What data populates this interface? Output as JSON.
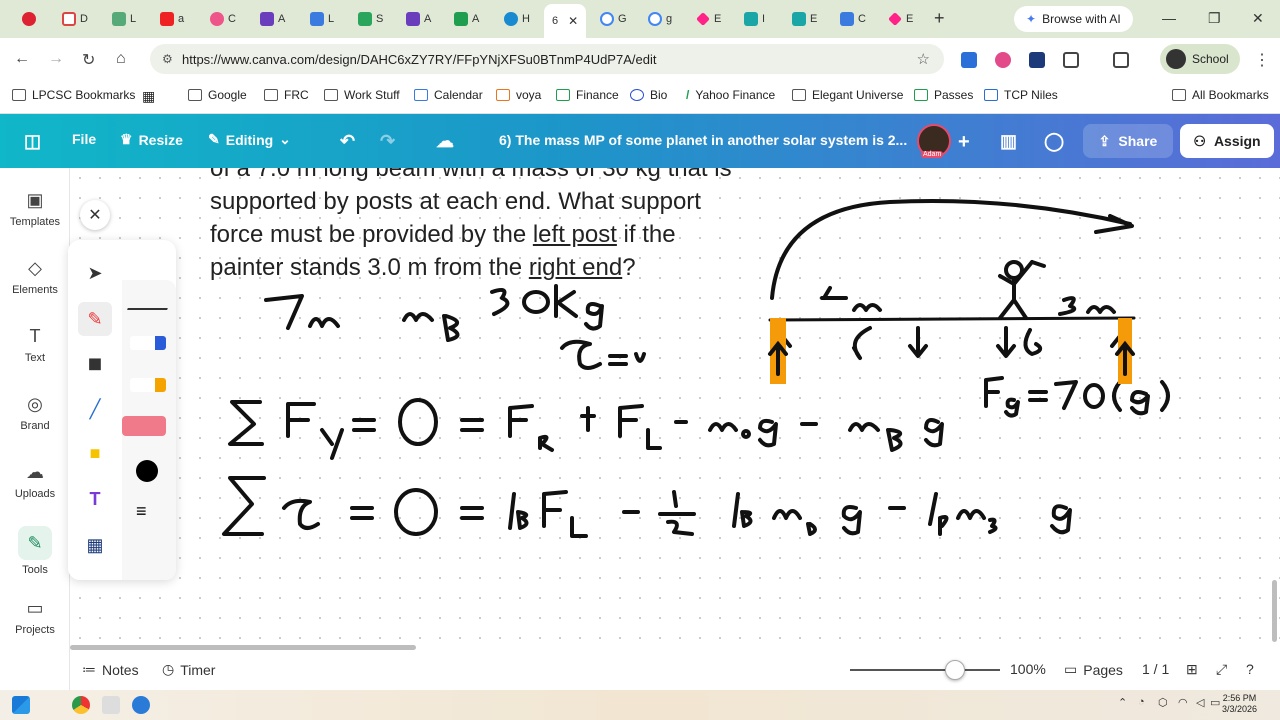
{
  "browser": {
    "tabs": [
      {
        "icon": "red-record-icon",
        "label": ""
      },
      {
        "icon": "gmail-icon",
        "label": "D"
      },
      {
        "icon": "chart-icon",
        "label": "L"
      },
      {
        "icon": "youtube-icon",
        "label": "a"
      },
      {
        "icon": "flower-icon",
        "label": "C"
      },
      {
        "icon": "forms-icon",
        "label": "A"
      },
      {
        "icon": "docs-icon",
        "label": "L"
      },
      {
        "icon": "drive-icon",
        "label": "S"
      },
      {
        "icon": "forms-icon",
        "label": "A"
      },
      {
        "icon": "sheets-icon",
        "label": "A"
      },
      {
        "icon": "edge-icon",
        "label": "H"
      },
      {
        "icon": "active-tab-icon",
        "label": "6"
      },
      {
        "icon": "google-icon",
        "label": "G"
      },
      {
        "icon": "google-icon",
        "label": "g"
      },
      {
        "icon": "diamond-icon",
        "label": "E"
      },
      {
        "icon": "sheet-icon",
        "label": "I"
      },
      {
        "icon": "sheet-icon",
        "label": "E"
      },
      {
        "icon": "docs-icon",
        "label": "C"
      },
      {
        "icon": "diamond-icon",
        "label": "E"
      }
    ],
    "browse_ai": "Browse with AI",
    "url": "https://www.canva.com/design/DAHC6xZY7RY/FFpYNjXFSu0BTnmP4UdP7A/edit",
    "profile_label": "School",
    "bookmarks": [
      "LPCSC Bookmarks",
      "Google",
      "FRC",
      "Work Stuff",
      "Calendar",
      "voya",
      "Finance",
      "Bio",
      "Yahoo Finance",
      "Elegant Universe",
      "Passes",
      "TCP Niles"
    ],
    "all_bookmarks": "All Bookmarks"
  },
  "canva": {
    "file": "File",
    "resize": "Resize",
    "editing": "Editing",
    "title": "6) The mass MP of some planet in another solar system is 2...",
    "share": "Share",
    "assign": "Assign",
    "avatar_label": "Adam"
  },
  "sidebar": {
    "items": [
      {
        "label": "Templates",
        "icon": "templates-icon"
      },
      {
        "label": "Elements",
        "icon": "elements-icon"
      },
      {
        "label": "Text",
        "icon": "text-icon"
      },
      {
        "label": "Brand",
        "icon": "brand-icon"
      },
      {
        "label": "Uploads",
        "icon": "uploads-icon"
      },
      {
        "label": "Tools",
        "icon": "tools-icon"
      },
      {
        "label": "Projects",
        "icon": "projects-icon"
      }
    ]
  },
  "canvas": {
    "problem_line1": "of a 7.0 m long beam with a mass of 30 kg that is",
    "problem_line2": "supported by posts at each end. What support",
    "problem_line3_pre": "force must be provided by the ",
    "problem_line3_u": "left post",
    "problem_line3_post": " if the",
    "problem_line4_pre": "painter stands 3.0 m from the ",
    "problem_line4_u": "right end",
    "problem_line4_post": "?"
  },
  "bottom": {
    "notes": "Notes",
    "timer": "Timer",
    "zoom": "100%",
    "zoom_level": 0.7,
    "pages": "Pages",
    "page_count": "1 / 1"
  },
  "taskbar": {
    "time": "2:56 PM",
    "date": "3/3/2026"
  },
  "colors": {
    "canva_gradient_start": "#10b7c8",
    "canva_gradient_end": "#5b6cd8",
    "post_orange": "#f59b0a",
    "tab_bar": "#dfe9d6"
  }
}
